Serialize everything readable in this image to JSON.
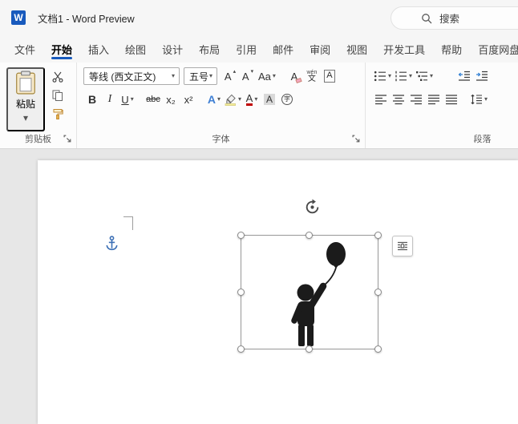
{
  "colors": {
    "accent": "#185abd",
    "font_color_bar": "#c00000",
    "highlight_bar": "#f5ee9e",
    "indent_arrow": "#2b7cd3"
  },
  "icons": {
    "dropdown": "▾",
    "up_triangle": "▴"
  },
  "title_bar": {
    "app_icon": "W",
    "title": "文档1  -  Word Preview",
    "search_label": "搜索"
  },
  "tabs": {
    "active": "开始",
    "items": [
      {
        "label": "文件"
      },
      {
        "label": "开始"
      },
      {
        "label": "插入"
      },
      {
        "label": "绘图"
      },
      {
        "label": "设计"
      },
      {
        "label": "布局"
      },
      {
        "label": "引用"
      },
      {
        "label": "邮件"
      },
      {
        "label": "审阅"
      },
      {
        "label": "视图"
      },
      {
        "label": "开发工具"
      },
      {
        "label": "帮助"
      },
      {
        "label": "百度网盘"
      }
    ]
  },
  "ribbon": {
    "clipboard": {
      "group_label": "剪贴板",
      "paste_label": "粘贴"
    },
    "font": {
      "group_label": "字体",
      "font_name_value": "等线 (西文正文)",
      "font_size_value": "五号",
      "grow": "A",
      "shrink": "A",
      "change_case": "Aa",
      "clear_format": "A",
      "phonetic_top": "wén",
      "phonetic_bottom": "文",
      "char_border": "A",
      "bold": "B",
      "italic": "I",
      "underline": "U",
      "strikethrough": "abc",
      "subscript": "x₂",
      "superscript": "x²",
      "text_effects": "A",
      "font_color": "A",
      "char_shading": "A",
      "enclose_char": "字"
    },
    "paragraph": {
      "group_label": "段落"
    }
  },
  "document": {
    "selected_object": "person-holding-balloon-clipart"
  }
}
